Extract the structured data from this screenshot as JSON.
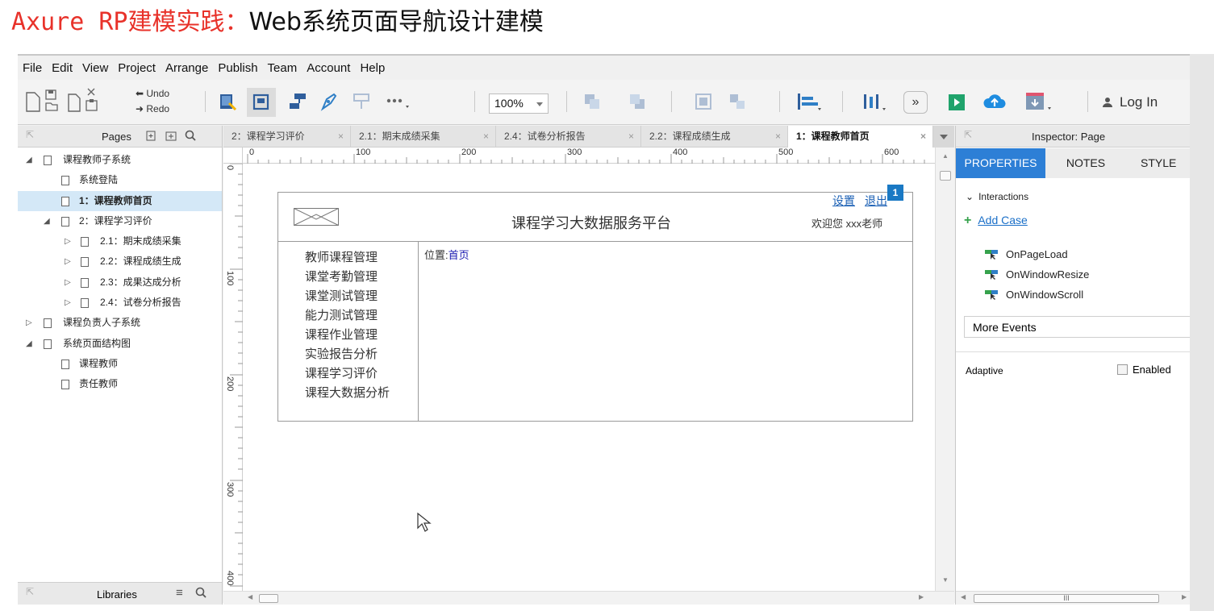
{
  "video_title": {
    "part1": "Axure RP",
    "part2": "建模实践：",
    "part3": "Web系统页面导航设计建模"
  },
  "menu": [
    "File",
    "Edit",
    "View",
    "Project",
    "Arrange",
    "Publish",
    "Team",
    "Account",
    "Help"
  ],
  "toolbar": {
    "undo_label": "Undo",
    "redo_label": "Redo",
    "zoom_value": "100%",
    "login_label": "Log In"
  },
  "pages_panel": {
    "title": "Pages",
    "tree": [
      {
        "label": "课程教师子系统",
        "level": 0,
        "arrow": "◢"
      },
      {
        "label": "系统登陆",
        "level": 1,
        "arrow": ""
      },
      {
        "label": "1：课程教师首页",
        "level": 1,
        "arrow": "",
        "selected": true
      },
      {
        "label": "2：课程学习评价",
        "level": 1,
        "arrow": "◢"
      },
      {
        "label": "2.1：期末成绩采集",
        "level": 2,
        "arrow": "▷"
      },
      {
        "label": "2.2：课程成绩生成",
        "level": 2,
        "arrow": "▷"
      },
      {
        "label": "2.3：成果达成分析",
        "level": 2,
        "arrow": "▷"
      },
      {
        "label": "2.4：试卷分析报告",
        "level": 2,
        "arrow": "▷"
      },
      {
        "label": "课程负责人子系统",
        "level": 0,
        "arrow": "▷"
      },
      {
        "label": "系统页面结构图",
        "level": 0,
        "arrow": "◢"
      },
      {
        "label": "课程教师",
        "level": 1,
        "arrow": ""
      },
      {
        "label": "责任教师",
        "level": 1,
        "arrow": ""
      }
    ]
  },
  "libraries_panel": {
    "title": "Libraries"
  },
  "tabs": [
    {
      "label": "2：课程学习评价",
      "active": false
    },
    {
      "label": "2.1：期末成绩采集",
      "active": false
    },
    {
      "label": "2.4：试卷分析报告",
      "active": false
    },
    {
      "label": "2.2：课程成绩生成",
      "active": false
    },
    {
      "label": "1：课程教师首页",
      "active": true
    }
  ],
  "rulers": {
    "h": [
      "0",
      "100",
      "200",
      "300",
      "400",
      "500",
      "600"
    ],
    "v": [
      "0",
      "100",
      "200",
      "300",
      "400"
    ]
  },
  "wireframe": {
    "title": "课程学习大数据服务平台",
    "link_settings": "设置",
    "link_logout": "退出",
    "welcome": "欢迎您 xxx老师",
    "badge": "1",
    "nav_items": [
      "教师课程管理",
      "课堂考勤管理",
      "课堂测试管理",
      "能力测试管理",
      "课程作业管理",
      "实验报告分析",
      "课程学习评价",
      "课程大数据分析"
    ],
    "location_label": "位置:",
    "location_link": "首页"
  },
  "inspector": {
    "title": "Inspector: Page",
    "tabs": [
      "PROPERTIES",
      "NOTES",
      "STYLE"
    ],
    "interactions_label": "Interactions",
    "add_case": "Add Case",
    "events": [
      "OnPageLoad",
      "OnWindowResize",
      "OnWindowScroll"
    ],
    "more_events": "More Events",
    "adaptive_label": "Adaptive",
    "enabled_label": "Enabled",
    "scroll_grip": "III"
  },
  "colors": {
    "title_red": "#e8322a",
    "accent_blue": "#2d7fd6",
    "link_blue": "#1a5fb4",
    "green": "#36a24c",
    "selected_row": "#d4e8f7"
  }
}
